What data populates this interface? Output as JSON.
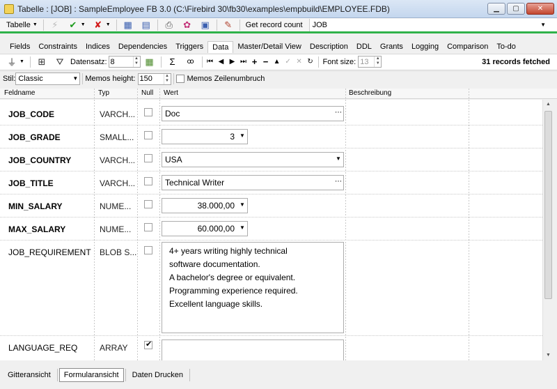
{
  "window": {
    "title": "Tabelle : [JOB] : SampleEmployee FB 3.0 (C:\\Firebird 30\\fb30\\examples\\empbuild\\EMPLOYEE.FDB)"
  },
  "toolbar1": {
    "table_label": "Tabelle",
    "get_record_count": "Get record count",
    "object_name": "JOB"
  },
  "tabs": [
    "Fields",
    "Constraints",
    "Indices",
    "Dependencies",
    "Triggers",
    "Data",
    "Master/Detail View",
    "Description",
    "DDL",
    "Grants",
    "Logging",
    "Comparison",
    "To-do"
  ],
  "active_tab": "Data",
  "toolbar2": {
    "datensatz_label": "Datensatz:",
    "datensatz_value": "8",
    "font_size_label": "Font size:",
    "font_size_value": "13",
    "records_fetched": "31 records fetched"
  },
  "toolbar3": {
    "stil_label": "Stil:",
    "stil_value": "Classic",
    "memos_height_label": "Memos height:",
    "memos_height_value": "150",
    "memos_wrap_label": "Memos Zeilenumbruch"
  },
  "grid_headers": {
    "feldname": "Feldname",
    "typ": "Typ",
    "null": "Null",
    "wert": "Wert",
    "beschreibung": "Beschreibung"
  },
  "fields": [
    {
      "name": "JOB_CODE",
      "type": "VARCH...",
      "null": false,
      "value": "Doc",
      "editor": "ellipsis"
    },
    {
      "name": "JOB_GRADE",
      "type": "SMALL...",
      "null": false,
      "value": "3",
      "editor": "numdrop"
    },
    {
      "name": "JOB_COUNTRY",
      "type": "VARCH...",
      "null": false,
      "value": "USA",
      "editor": "dropdown"
    },
    {
      "name": "JOB_TITLE",
      "type": "VARCH...",
      "null": false,
      "value": "Technical Writer",
      "editor": "ellipsis"
    },
    {
      "name": "MIN_SALARY",
      "type": "NUME...",
      "null": false,
      "value": "38.000,00",
      "editor": "numdrop"
    },
    {
      "name": "MAX_SALARY",
      "type": "NUME...",
      "null": false,
      "value": "60.000,00",
      "editor": "numdrop"
    },
    {
      "name": "JOB_REQUIREMENT",
      "type": "BLOB S...",
      "null": false,
      "value": "4+ years writing highly technical\nsoftware documentation.\nA bachelor's degree or equivalent.\nProgramming experience required.\nExcellent language skills.",
      "editor": "memo"
    },
    {
      "name": "LANGUAGE_REQ",
      "type": "ARRAY",
      "null": true,
      "value": "",
      "editor": "memo"
    }
  ],
  "bottom_tabs": [
    "Gitteransicht",
    "Formularansicht",
    "Daten Drucken"
  ],
  "active_bottom_tab": "Formularansicht"
}
